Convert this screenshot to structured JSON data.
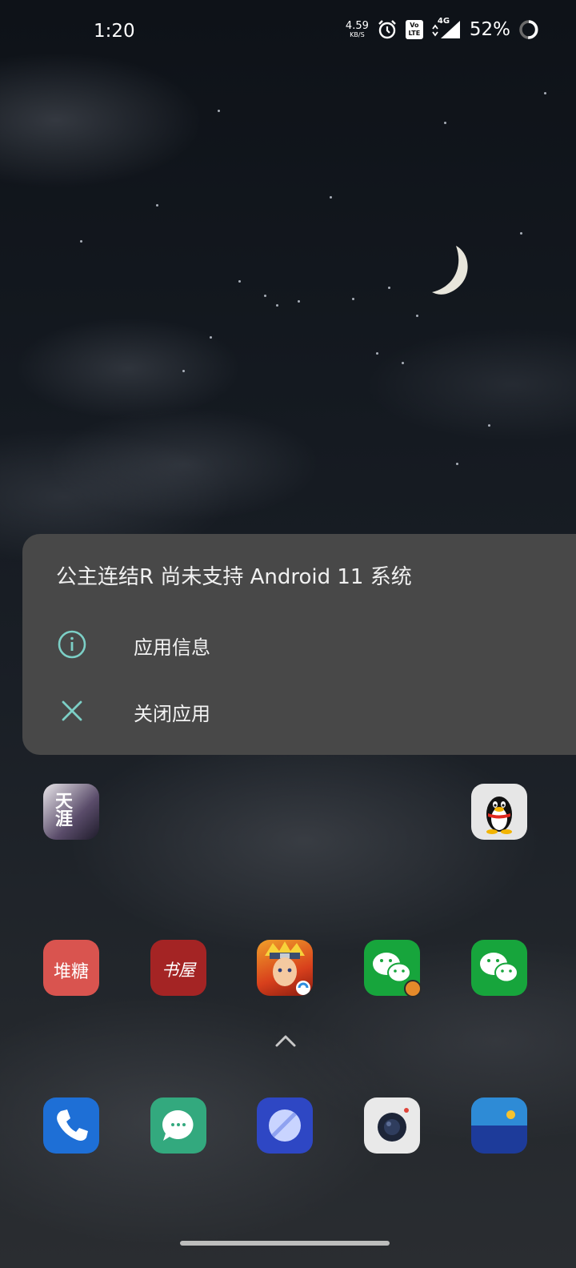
{
  "status_bar": {
    "time": "1:20",
    "net_speed_value": "4.59",
    "net_speed_unit": "KB/S",
    "volte_label": "Vo LTE",
    "network_type": "4G",
    "battery_percent": "52%"
  },
  "dialog": {
    "title": "公主连结R 尚未支持 Android 11 系统",
    "items": [
      {
        "label": "应用信息",
        "icon": "info-icon"
      },
      {
        "label": "关闭应用",
        "icon": "close-icon"
      }
    ],
    "accent_color": "#7ccfc6"
  },
  "home": {
    "row1": [
      {
        "name": "tianya-mingyuedao-app",
        "icon_text": "天涯"
      },
      {
        "name": "qq-app"
      }
    ],
    "row2": [
      {
        "name": "duitang-app",
        "icon_text": "堆糖"
      },
      {
        "name": "shuwu-app",
        "icon_text": "书屋"
      },
      {
        "name": "naruto-game-app"
      },
      {
        "name": "wechat-clone-app"
      },
      {
        "name": "wechat-app"
      }
    ],
    "dock": [
      {
        "name": "phone-app"
      },
      {
        "name": "messages-app"
      },
      {
        "name": "browser-app"
      },
      {
        "name": "camera-app"
      },
      {
        "name": "gallery-app"
      }
    ]
  }
}
